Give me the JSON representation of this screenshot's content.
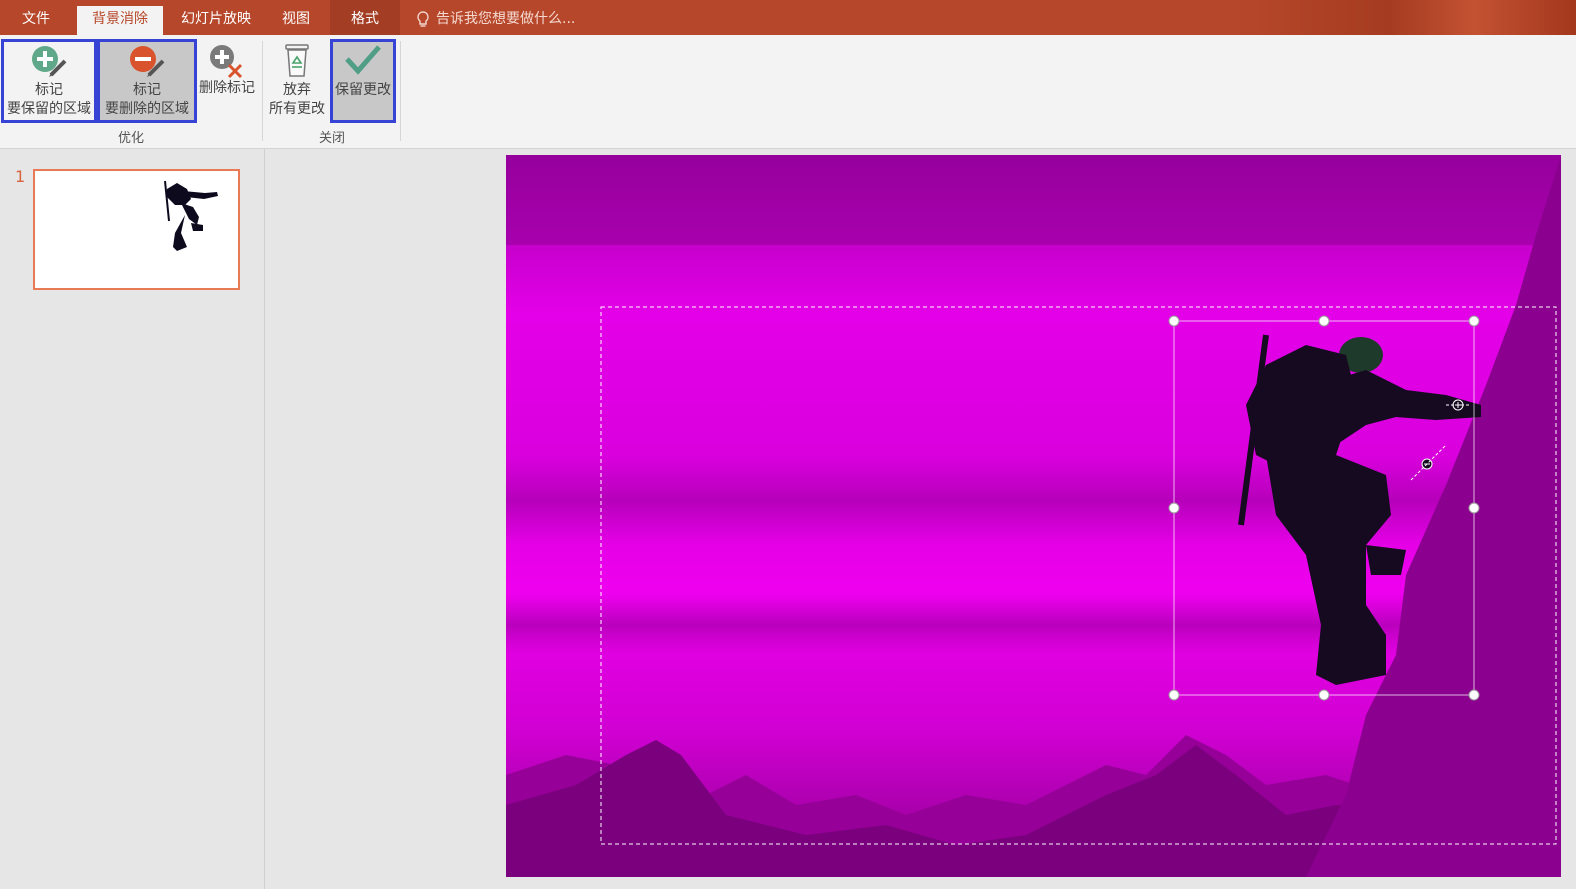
{
  "tabs": [
    {
      "label": "文件"
    },
    {
      "label": "背景消除"
    },
    {
      "label": "幻灯片放映"
    },
    {
      "label": "视图"
    },
    {
      "label": "格式"
    }
  ],
  "tell_me": {
    "placeholder": "告诉我您想要做什么..."
  },
  "ribbon": {
    "mark_keep": {
      "line1": "标记",
      "line2": "要保留的区域",
      "icon": "plus-pencil-icon"
    },
    "mark_remove": {
      "line1": "标记",
      "line2": "要删除的区域",
      "icon": "minus-pencil-icon"
    },
    "delete_mark": {
      "label": "删除标记",
      "icon": "delete-mark-icon"
    },
    "discard": {
      "line1": "放弃",
      "line2": "所有更改",
      "icon": "recycle-bin-icon"
    },
    "keep_changes": {
      "label": "保留更改",
      "icon": "checkmark-icon"
    },
    "group_refine": "优化",
    "group_close": "关闭"
  },
  "thumbnails": [
    {
      "number": "1"
    }
  ],
  "colors": {
    "tabbar": "#b7472a",
    "removed_area_overlay": "#e600e6",
    "highlight_outline": "#3643d4",
    "thumbnail_border": "#e97a56"
  }
}
